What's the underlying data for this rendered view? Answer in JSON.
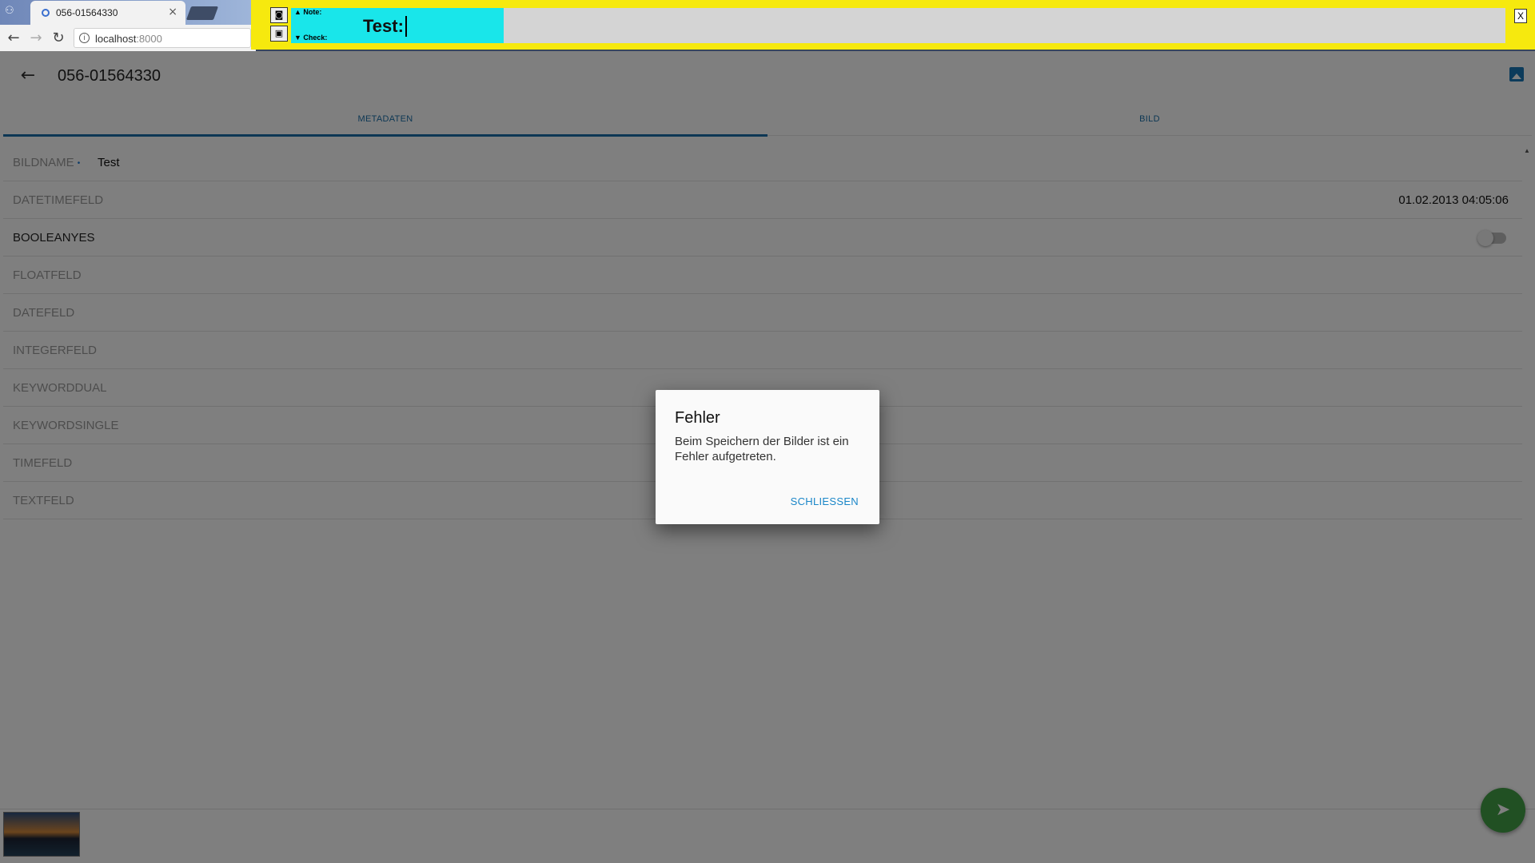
{
  "browser": {
    "tab_title": "056-01564330",
    "tab_close": "×",
    "url_host": "localhost",
    "url_port": ":8000"
  },
  "note_overlay": {
    "note_label": "▲ Note:",
    "check_label": "▼ Check:",
    "text": "Test:",
    "close_label": "X"
  },
  "app": {
    "title": "056-01564330",
    "tabs": [
      {
        "label": "METADATEN"
      },
      {
        "label": "BILD"
      }
    ],
    "fields": [
      {
        "label": "BILDNAME",
        "value": "Test"
      },
      {
        "label": "DATETIMEFELD",
        "value": "01.02.2013 04:05:06"
      },
      {
        "label": "BOOLEANYES",
        "value": "false"
      },
      {
        "label": "FLOATFELD",
        "value": ""
      },
      {
        "label": "DATEFELD",
        "value": ""
      },
      {
        "label": "INTEGERFELD",
        "value": ""
      },
      {
        "label": "KEYWORDDUAL",
        "value": ""
      },
      {
        "label": "KEYWORDSINGLE",
        "value": ""
      },
      {
        "label": "TIMEFELD",
        "value": ""
      },
      {
        "label": "TEXTFELD",
        "value": ""
      }
    ]
  },
  "dialog": {
    "title": "Fehler",
    "message": "Beim Speichern der Bilder ist ein Fehler aufgetreten.",
    "button": "SCHLIESSEN"
  },
  "colors": {
    "accent": "#1a6fa8",
    "fab": "#43a047",
    "note_bg": "#f6e90e",
    "note_highlight": "#19e6ea"
  },
  "icons": {
    "back": "arrow-left-icon",
    "image": "image-icon",
    "send": "send-icon"
  }
}
